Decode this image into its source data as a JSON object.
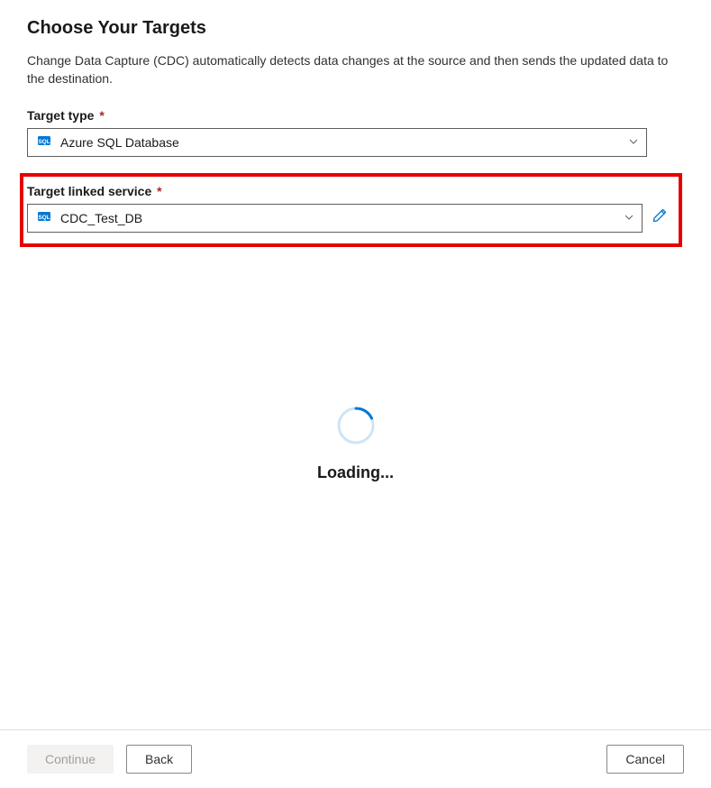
{
  "page": {
    "title": "Choose Your Targets",
    "description": "Change Data Capture (CDC) automatically detects data changes at the source and then sends the updated data to the destination."
  },
  "fields": {
    "targetType": {
      "label": "Target type",
      "required": "*",
      "value": "Azure SQL Database",
      "iconName": "azure-sql-icon"
    },
    "targetLinkedService": {
      "label": "Target linked service",
      "required": "*",
      "value": "CDC_Test_DB",
      "iconName": "azure-sql-icon"
    }
  },
  "loading": {
    "text": "Loading..."
  },
  "footer": {
    "continueLabel": "Continue",
    "backLabel": "Back",
    "cancelLabel": "Cancel"
  },
  "colors": {
    "highlight": "#e60000",
    "accent": "#0078d4",
    "requiredMark": "#a4262c"
  }
}
